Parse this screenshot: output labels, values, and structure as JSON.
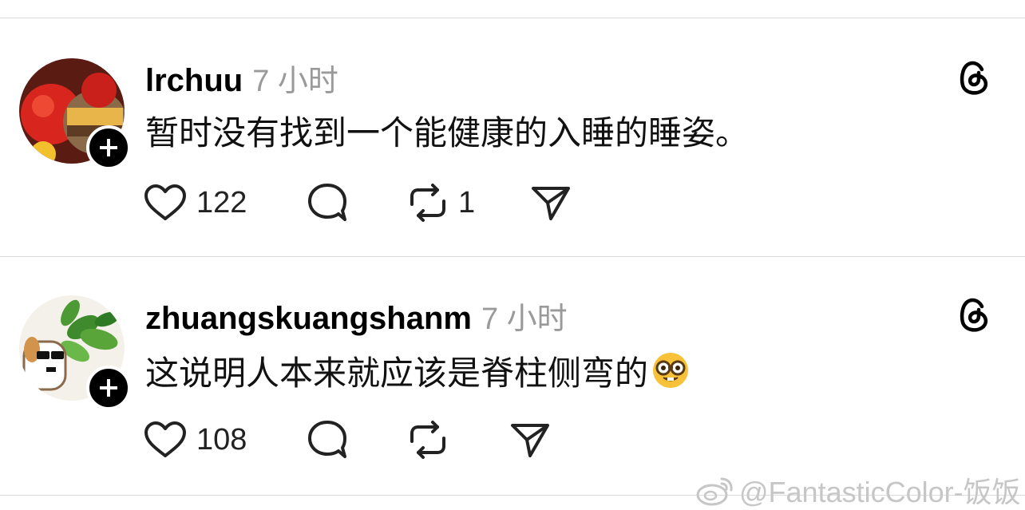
{
  "posts": [
    {
      "username": "lrchuu",
      "time": "7 小时",
      "text": "暂时没有找到一个能健康的入睡的睡姿。",
      "likes": "122",
      "reposts": "1"
    },
    {
      "username": "zhuangskuangshanm",
      "time": "7 小时",
      "text": "这说明人本来就应该是脊柱侧弯的",
      "emoji": "nerd-face",
      "likes": "108",
      "reposts": ""
    }
  ],
  "watermark": "@FantasticColor-饭饭",
  "icons": {
    "like": "heart-icon",
    "comment": "comment-bubble-icon",
    "repost": "repost-icon",
    "share": "send-icon",
    "menu": "threads-logo-icon",
    "follow": "plus-icon"
  }
}
